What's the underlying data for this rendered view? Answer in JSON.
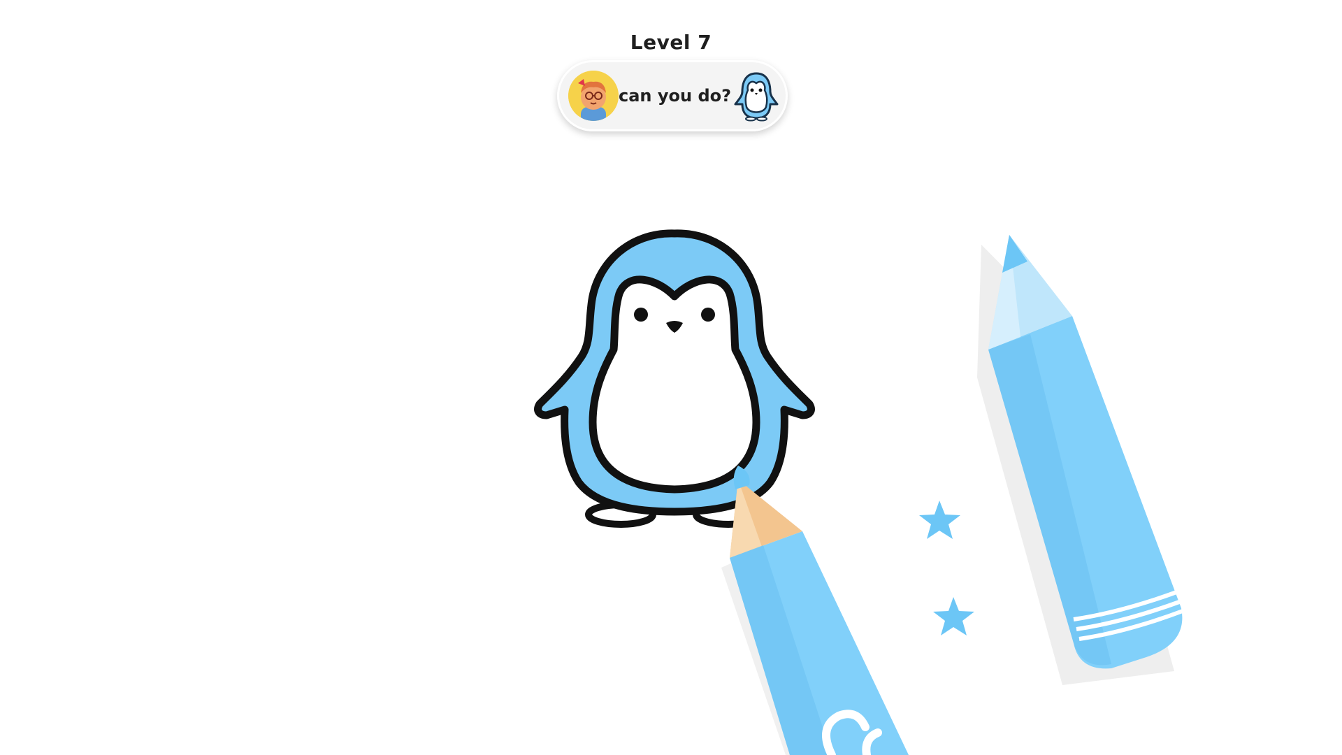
{
  "hud": {
    "level_label": "Level 7",
    "prompt_text": "can you do?"
  },
  "icons": {
    "avatar": "cartoon-girl-avatar-icon",
    "target": "penguin-thumbnail-icon",
    "drawing": "penguin-drawing",
    "pencil": "blue-pencil-icon",
    "stars": "star-icon"
  },
  "colors": {
    "penguin_blue": "#7ccaf6",
    "pencil_blue": "#81d0fa",
    "outline": "#111111",
    "star": "#6cc6f6",
    "avatar_bg": "#f6d24a"
  }
}
